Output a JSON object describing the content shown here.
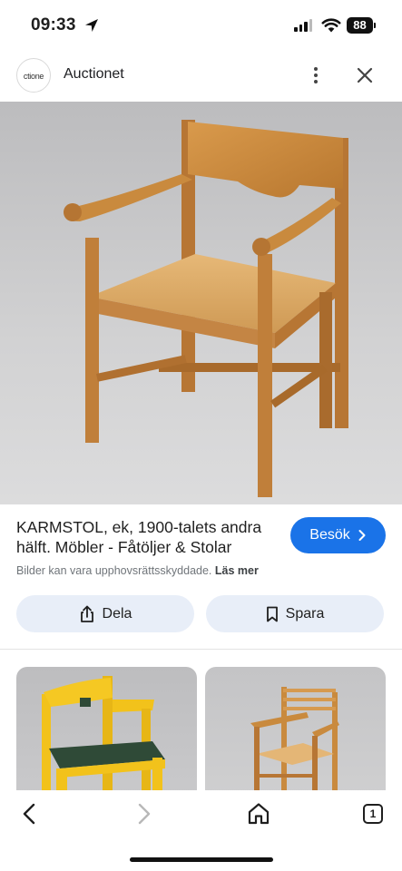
{
  "status_bar": {
    "time": "09:33",
    "battery": "88",
    "icons": [
      "location-arrow-icon",
      "signal-icon",
      "wifi-icon",
      "battery-icon"
    ]
  },
  "header": {
    "site_logo_text": "ctione",
    "site_name": "Auctionet",
    "icons": [
      "more-vertical-icon",
      "close-icon"
    ]
  },
  "result": {
    "title": "KARMSTOL, ek, 1900-talets andra hälft. Möbler - Fåtöljer & Stolar",
    "visit_label": "Besök",
    "copyright_text": "Bilder kan vara upphovsrättsskyddade.",
    "read_more_label": "Läs mer"
  },
  "actions": {
    "share_label": "Dela",
    "save_label": "Spara"
  },
  "bottom_nav": {
    "tab_count": "1",
    "icons": [
      "back-icon",
      "forward-icon",
      "home-icon",
      "tabs-icon"
    ]
  },
  "colors": {
    "accent": "#1a73e8",
    "action_button_bg": "#e8eef8",
    "oak": "#c98a3e"
  }
}
